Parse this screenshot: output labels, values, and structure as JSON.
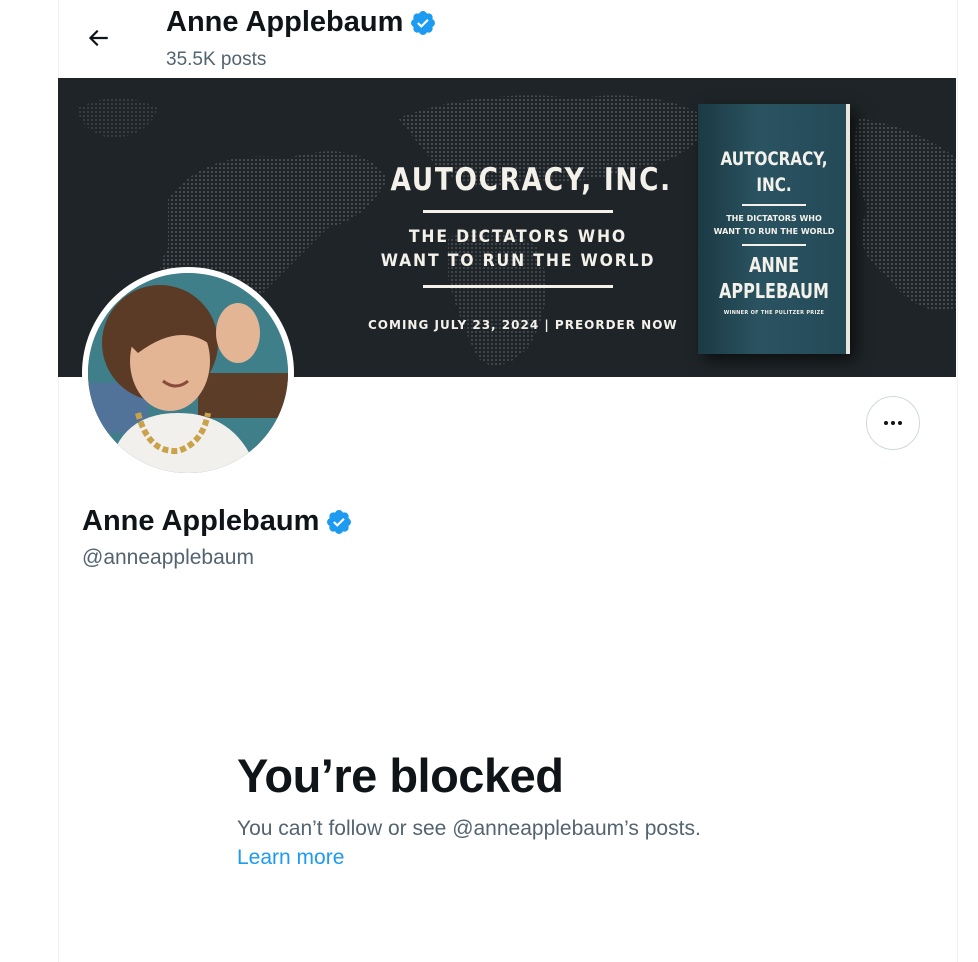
{
  "header": {
    "name": "Anne Applebaum",
    "post_count": "35.5K posts"
  },
  "banner": {
    "title": "AUTOCRACY, INC.",
    "subtitle_line1": "THE DICTATORS WHO",
    "subtitle_line2": "WANT TO RUN THE WORLD",
    "coming": "COMING JULY 23, 2024 | PREORDER NOW",
    "book": {
      "title_line1": "AUTOCRACY,",
      "title_line2": "INC.",
      "subtitle_line1": "THE DICTATORS WHO",
      "subtitle_line2": "WANT TO RUN THE WORLD",
      "author_line1": "ANNE",
      "author_line2": "APPLEBAUM",
      "prize": "WINNER OF THE PULITZER PRIZE"
    }
  },
  "profile": {
    "name": "Anne Applebaum",
    "handle": "@anneapplebaum"
  },
  "blocked": {
    "title": "You’re blocked",
    "message": "You can’t follow or see @anneapplebaum’s posts.",
    "learn_more": "Learn more"
  },
  "colors": {
    "verified": "#1d9bf0",
    "link": "#1d9bf0",
    "secondary_text": "#536471"
  },
  "icons": {
    "back": "arrow-left-icon",
    "verified": "verified-badge-icon",
    "more": "more-horizontal-icon"
  }
}
